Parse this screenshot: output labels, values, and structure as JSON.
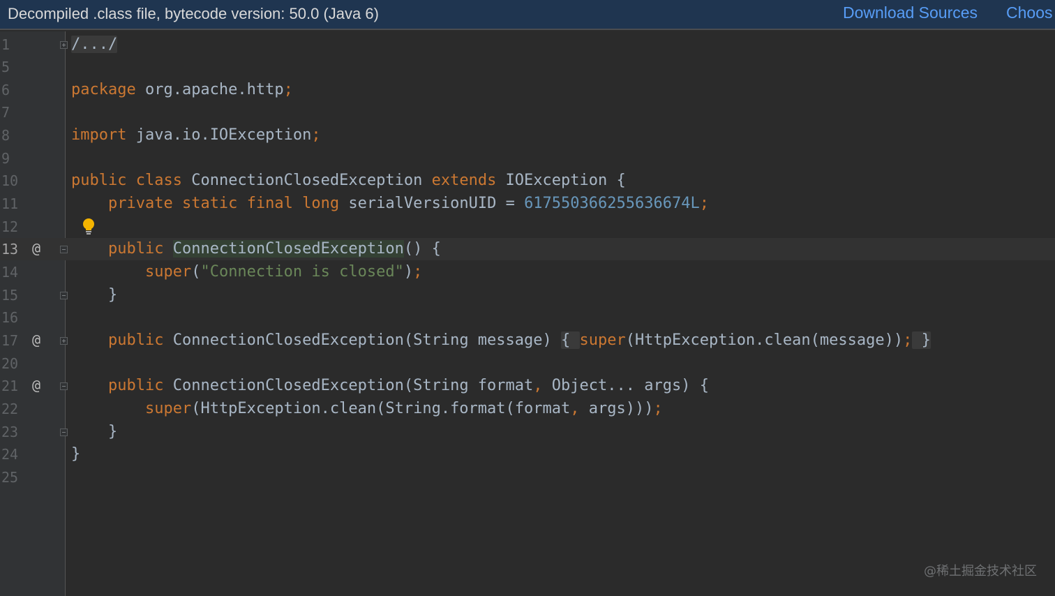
{
  "banner": {
    "title": "Decompiled .class file, bytecode version: 50.0 (Java 6)",
    "download_sources": "Download Sources",
    "choose_sources": "Choos"
  },
  "gutter": {
    "line_numbers": [
      "1",
      "5",
      "6",
      "7",
      "8",
      "9",
      "10",
      "11",
      "12",
      "13",
      "14",
      "15",
      "16",
      "17",
      "20",
      "21",
      "22",
      "23",
      "24",
      "25"
    ],
    "override_marker": "@"
  },
  "code": {
    "l1_folded": "/.../",
    "l6_kw": "package",
    "l6_rest": " org.apache.http",
    "semicolon": ";",
    "l8_kw": "import",
    "l8_rest": " java.io.IOException",
    "l10_public": "public",
    "l10_class": "class",
    "l10_name": " ConnectionClosedException ",
    "l10_extends": "extends",
    "l10_rest": " IOException {",
    "l11_private": "private",
    "l11_static": "static",
    "l11_final": "final",
    "l11_long": "long",
    "l11_field": " serialVersionUID = ",
    "l11_value": "617550366255636674L",
    "l13_public": "public",
    "l13_name": "ConnectionClosedException",
    "l13_rest": "() {",
    "l14_super": "super",
    "l14_open": "(",
    "l14_string": "\"Connection is closed\"",
    "l14_close": ")",
    "close_brace": "}",
    "l17_public": "public",
    "l17_sig": " ConnectionClosedException(String message) ",
    "l17_open": "{ ",
    "l17_super": "super",
    "l17_args": "(HttpException.clean(message))",
    "l17_close": " }",
    "l21_public": "public",
    "l21_sig": " ConnectionClosedException(String format",
    "comma": ",",
    "l21_rest": " Object... args) {",
    "l22_super": "super",
    "l22_args1": "(HttpException.clean(String.format(format",
    "l22_args2": " args)))"
  },
  "watermark": "@稀土掘金技术社区",
  "colors": {
    "background": "#2b2b2b",
    "keyword": "#cc7832",
    "string": "#6a8759",
    "number": "#6897bb",
    "identifier": "#a9b7c6",
    "link": "#589df6",
    "banner": "#1f3550"
  },
  "icons": [
    "fold-expand-icon",
    "fold-collapse-icon",
    "override-icon",
    "lightbulb-icon"
  ]
}
